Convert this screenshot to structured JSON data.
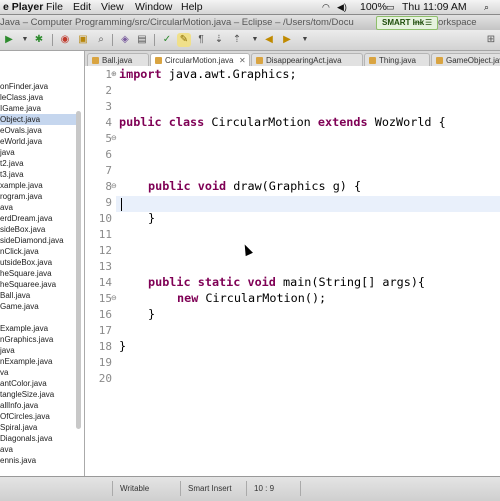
{
  "menubar": {
    "app": "e Player",
    "items": [
      "File",
      "Edit",
      "View",
      "Window",
      "Help"
    ],
    "battery": "100%",
    "clock": "Thu 11:09 AM"
  },
  "window": {
    "title": "Java – Computer Programming/src/CircularMotion.java – Eclipse – /Users/tom/Docu",
    "title_tail": "orkspace"
  },
  "smart_ink": {
    "label": "SMART Ink",
    "dash": "—"
  },
  "toolbar": {
    "buttons": [
      "run",
      "debug",
      "coverage",
      "external-tools",
      "new-class",
      "search",
      "previous-annotation",
      "next-annotation",
      "back",
      "forward"
    ]
  },
  "sidebar": {
    "files": [
      "onFinder.java",
      "leClass.java",
      "IGame.java",
      "Object.java",
      "eOvals.java",
      "eWorld.java",
      "java",
      "t2.java",
      "t3.java",
      "xample.java",
      "rogram.java",
      "ava",
      "erdDream.java",
      "sideBox.java",
      "sideDiamond.java",
      "nClick.java",
      "utsideBox.java",
      "heSquare.java",
      "heSquaree.java",
      "Ball.java",
      "Game.java",
      "",
      "Example.java",
      "nGraphics.java",
      "java",
      "nExample.java",
      "va",
      "antColor.java",
      "tangleSize.java",
      "allInfo.java",
      "OfCircles.java",
      "Spiral.java",
      "Diagonals.java",
      "ava",
      "ennis.java"
    ],
    "selected_index": 3
  },
  "tabs": [
    {
      "label": "Ball.java",
      "close": "",
      "active": false
    },
    {
      "label": "CircularMotion.java",
      "close": "✕",
      "active": true
    },
    {
      "label": "DisappearingAct.java",
      "close": "",
      "active": false
    },
    {
      "label": "Thing.java",
      "close": "",
      "active": false
    },
    {
      "label": "GameObject.java",
      "close": "",
      "active": false
    }
  ],
  "editor": {
    "line_numbers": [
      "1",
      "2",
      "3",
      "4",
      "5",
      "6",
      "7",
      "8",
      "9",
      "10",
      "11",
      "12",
      "13",
      "14",
      "15",
      "16",
      "17",
      "18",
      "19",
      "20"
    ],
    "lines": {
      "l1_kw": "import",
      "l1_rest": " java.awt.Graphics;",
      "l5_kw1": "public",
      "l5_kw2": "class",
      "l5_name": " CircularMotion ",
      "l5_kw3": "extends",
      "l5_rest": " WozWorld {",
      "l9_kw1": "public",
      "l9_kw2": "void",
      "l9_rest": " draw(Graphics g) {",
      "l11": "}",
      "l15_kw1": "public",
      "l15_kw2": "static",
      "l15_kw3": "void",
      "l15_rest": " main(String[] args){",
      "l16_kw": "new",
      "l16_rest": " CircularMotion();",
      "l17": "}",
      "l19": "}"
    },
    "current_line": 10
  },
  "status": {
    "writable": "Writable",
    "insert_mode": "Smart Insert",
    "position": "10 : 9"
  }
}
